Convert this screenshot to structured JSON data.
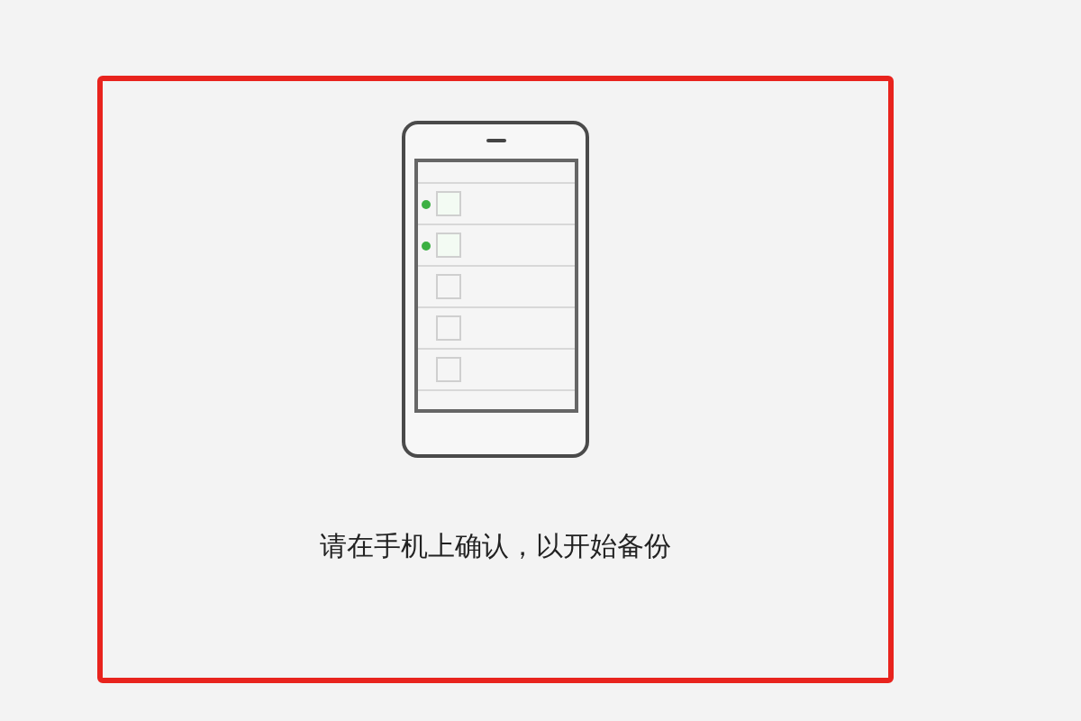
{
  "phone_rows": [
    {
      "marked": true
    },
    {
      "marked": true
    },
    {
      "marked": false
    },
    {
      "marked": false
    },
    {
      "marked": false
    }
  ],
  "message": "请在手机上确认，以开始备份"
}
